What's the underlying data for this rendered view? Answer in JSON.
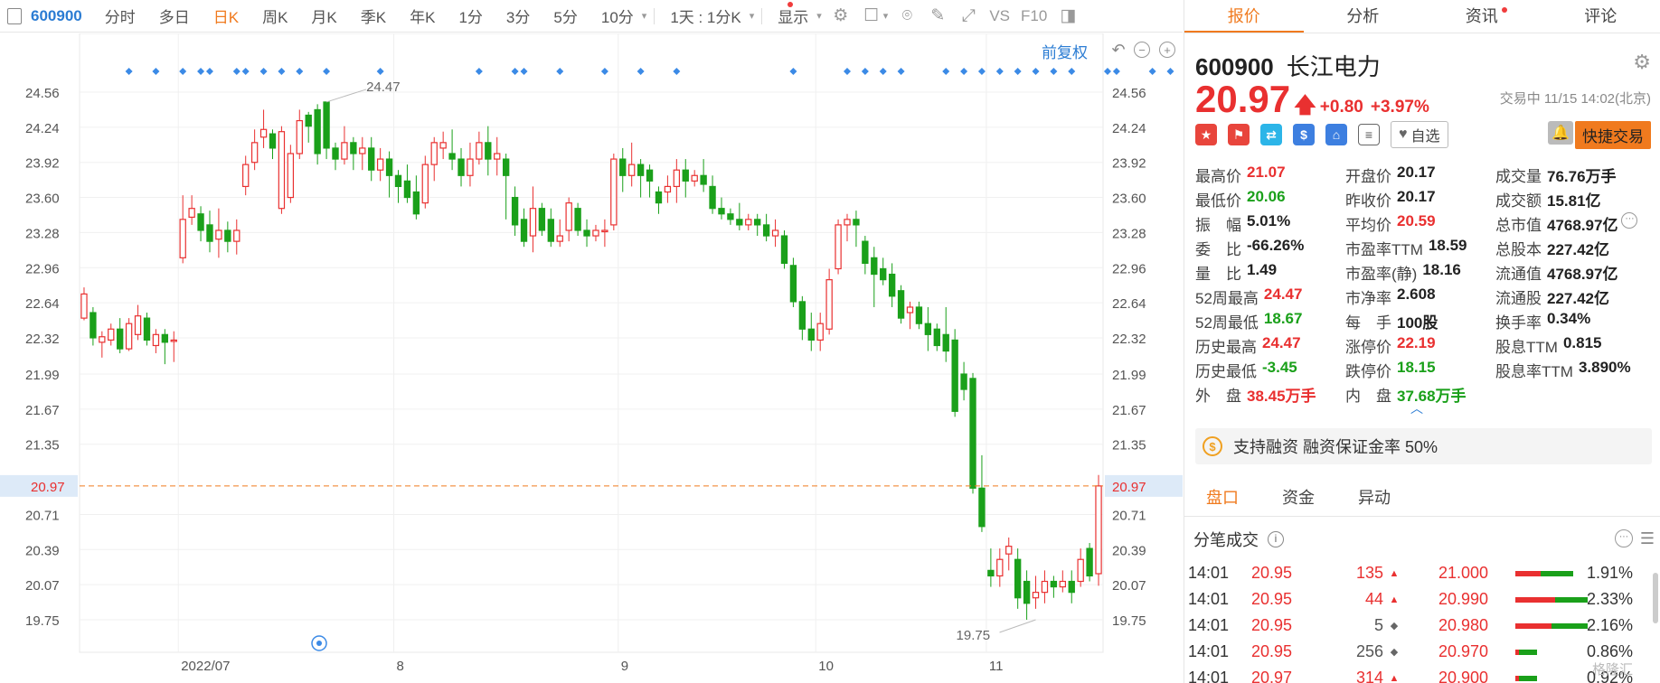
{
  "toolbar": {
    "code": "600900",
    "tabs": [
      "分时",
      "多日",
      "日K",
      "周K",
      "月K",
      "季K",
      "年K",
      "1分",
      "3分",
      "5分",
      "10分"
    ],
    "active_tab": "日K",
    "interval": "1天 : 1分K",
    "display": "显示",
    "vs": "VS",
    "f10": "F10"
  },
  "chart": {
    "restore_label": "前复权",
    "y_ticks": [
      "24.56",
      "24.24",
      "23.92",
      "23.60",
      "23.28",
      "22.96",
      "22.64",
      "22.32",
      "21.99",
      "21.67",
      "21.35",
      "20.71",
      "20.39",
      "20.07",
      "19.75"
    ],
    "x_ticks": [
      "2022/07",
      "8",
      "9",
      "10",
      "11"
    ],
    "current_price_label": "20.97",
    "high_marker": "24.47",
    "low_marker": "19.75",
    "colors": {
      "up": "#e93030",
      "down": "#1aa01a",
      "accent": "#f07a1e",
      "link": "#2b7cd3"
    }
  },
  "chart_data": {
    "type": "candlestick",
    "ylim": [
      19.5,
      24.75
    ],
    "current_price": 20.97,
    "high": 24.47,
    "low": 19.75,
    "candles": [
      [
        22.5,
        22.72,
        22.48,
        22.78
      ],
      [
        22.55,
        22.32,
        22.25,
        22.6
      ],
      [
        22.28,
        22.33,
        22.14,
        22.38
      ],
      [
        22.3,
        22.4,
        22.25,
        22.45
      ],
      [
        22.4,
        22.22,
        22.18,
        22.5
      ],
      [
        22.22,
        22.45,
        22.2,
        22.5
      ],
      [
        22.35,
        22.52,
        22.3,
        22.62
      ],
      [
        22.5,
        22.3,
        22.25,
        22.55
      ],
      [
        22.25,
        22.35,
        22.18,
        22.4
      ],
      [
        22.35,
        22.28,
        22.08,
        22.4
      ],
      [
        22.3,
        22.3,
        22.1,
        22.38
      ],
      [
        23.05,
        23.4,
        23.0,
        23.62
      ],
      [
        23.42,
        23.5,
        23.35,
        23.62
      ],
      [
        23.45,
        23.3,
        23.2,
        23.52
      ],
      [
        23.35,
        23.2,
        23.1,
        23.48
      ],
      [
        23.22,
        23.3,
        23.05,
        23.5
      ],
      [
        23.3,
        23.2,
        23.1,
        23.38
      ],
      [
        23.2,
        23.3,
        23.08,
        23.4
      ],
      [
        23.7,
        23.9,
        23.62,
        23.98
      ],
      [
        23.92,
        24.1,
        23.85,
        24.22
      ],
      [
        24.15,
        24.22,
        24.05,
        24.4
      ],
      [
        24.18,
        24.05,
        23.95,
        24.22
      ],
      [
        23.5,
        24.2,
        23.45,
        24.25
      ],
      [
        23.6,
        24.0,
        23.55,
        24.08
      ],
      [
        24.0,
        24.3,
        23.95,
        24.4
      ],
      [
        24.35,
        24.25,
        24.1,
        24.38
      ],
      [
        24.4,
        24.0,
        23.9,
        24.45
      ],
      [
        24.47,
        24.05,
        23.95,
        24.47
      ],
      [
        24.05,
        23.95,
        23.85,
        24.1
      ],
      [
        23.95,
        24.1,
        23.9,
        24.25
      ],
      [
        24.1,
        24.0,
        23.85,
        24.15
      ],
      [
        24.0,
        24.05,
        23.85,
        24.15
      ],
      [
        24.05,
        23.85,
        23.75,
        24.15
      ],
      [
        23.85,
        23.95,
        23.75,
        24.05
      ],
      [
        23.95,
        23.8,
        23.6,
        24.02
      ],
      [
        23.8,
        23.7,
        23.55,
        23.85
      ],
      [
        23.75,
        23.6,
        23.55,
        23.9
      ],
      [
        23.65,
        23.45,
        23.4,
        23.8
      ],
      [
        23.55,
        23.9,
        23.5,
        23.98
      ],
      [
        23.9,
        24.1,
        23.75,
        24.15
      ],
      [
        24.05,
        24.1,
        23.95,
        24.2
      ],
      [
        24.0,
        23.95,
        23.85,
        24.22
      ],
      [
        23.95,
        23.8,
        23.7,
        24.05
      ],
      [
        23.8,
        23.95,
        23.7,
        24.1
      ],
      [
        23.95,
        24.1,
        23.9,
        24.2
      ],
      [
        24.1,
        23.95,
        23.8,
        24.25
      ],
      [
        23.95,
        24.0,
        23.8,
        24.15
      ],
      [
        23.95,
        23.8,
        23.4,
        24.0
      ],
      [
        23.6,
        23.35,
        23.25,
        23.7
      ],
      [
        23.4,
        23.2,
        23.15,
        23.5
      ],
      [
        23.25,
        23.5,
        23.1,
        23.7
      ],
      [
        23.5,
        23.3,
        23.25,
        23.55
      ],
      [
        23.4,
        23.2,
        23.15,
        23.5
      ],
      [
        23.2,
        23.25,
        23.15,
        23.4
      ],
      [
        23.3,
        23.55,
        23.2,
        23.6
      ],
      [
        23.5,
        23.3,
        23.25,
        23.55
      ],
      [
        23.3,
        23.25,
        23.15,
        23.4
      ],
      [
        23.25,
        23.3,
        23.2,
        23.35
      ],
      [
        23.3,
        23.3,
        23.15,
        23.4
      ],
      [
        23.35,
        23.95,
        23.3,
        24.0
      ],
      [
        23.95,
        23.8,
        23.65,
        24.05
      ],
      [
        23.8,
        23.9,
        23.7,
        24.1
      ],
      [
        23.9,
        23.8,
        23.6,
        23.95
      ],
      [
        23.85,
        23.75,
        23.6,
        23.9
      ],
      [
        23.65,
        23.55,
        23.45,
        23.7
      ],
      [
        23.65,
        23.7,
        23.55,
        23.8
      ],
      [
        23.7,
        23.85,
        23.55,
        23.95
      ],
      [
        23.85,
        23.75,
        23.6,
        23.95
      ],
      [
        23.75,
        23.8,
        23.7,
        23.85
      ],
      [
        23.8,
        23.72,
        23.65,
        23.95
      ],
      [
        23.7,
        23.5,
        23.45,
        23.8
      ],
      [
        23.5,
        23.45,
        23.4,
        23.6
      ],
      [
        23.45,
        23.4,
        23.35,
        23.5
      ],
      [
        23.4,
        23.35,
        23.3,
        23.55
      ],
      [
        23.35,
        23.4,
        23.3,
        23.45
      ],
      [
        23.4,
        23.35,
        23.25,
        23.45
      ],
      [
        23.35,
        23.25,
        23.2,
        23.45
      ],
      [
        23.25,
        23.3,
        23.15,
        23.4
      ],
      [
        23.25,
        23.0,
        22.95,
        23.3
      ],
      [
        22.98,
        22.65,
        22.6,
        23.05
      ],
      [
        22.65,
        22.4,
        22.3,
        22.7
      ],
      [
        22.4,
        22.3,
        22.2,
        22.55
      ],
      [
        22.3,
        22.45,
        22.2,
        22.55
      ],
      [
        22.4,
        22.85,
        22.35,
        22.95
      ],
      [
        22.95,
        23.35,
        22.9,
        23.4
      ],
      [
        23.35,
        23.4,
        23.2,
        23.45
      ],
      [
        23.4,
        23.35,
        23.15,
        23.48
      ],
      [
        23.2,
        23.0,
        22.9,
        23.25
      ],
      [
        23.05,
        22.9,
        22.6,
        23.15
      ],
      [
        22.95,
        22.85,
        22.8,
        23.05
      ],
      [
        22.9,
        22.7,
        22.6,
        23.0
      ],
      [
        22.75,
        22.5,
        22.45,
        22.8
      ],
      [
        22.55,
        22.6,
        22.4,
        22.65
      ],
      [
        22.6,
        22.45,
        22.4,
        22.65
      ],
      [
        22.45,
        22.35,
        22.2,
        22.6
      ],
      [
        22.4,
        22.25,
        22.2,
        22.45
      ],
      [
        22.35,
        22.2,
        22.1,
        22.6
      ],
      [
        22.3,
        21.65,
        21.6,
        22.4
      ],
      [
        21.99,
        21.85,
        21.75,
        22.1
      ],
      [
        21.95,
        20.95,
        20.9,
        22.0
      ],
      [
        20.95,
        20.6,
        20.55,
        21.25
      ],
      [
        20.2,
        20.15,
        20.05,
        20.4
      ],
      [
        20.15,
        20.3,
        20.05,
        20.4
      ],
      [
        20.35,
        20.42,
        20.2,
        20.5
      ],
      [
        20.3,
        19.95,
        19.85,
        20.4
      ],
      [
        20.1,
        19.9,
        19.75,
        20.2
      ],
      [
        19.95,
        20.0,
        19.85,
        20.15
      ],
      [
        20.0,
        20.1,
        19.9,
        20.2
      ],
      [
        20.1,
        20.05,
        19.95,
        20.15
      ],
      [
        20.05,
        20.1,
        20.0,
        20.2
      ],
      [
        20.1,
        20.0,
        19.9,
        20.2
      ],
      [
        20.1,
        20.3,
        20.05,
        20.4
      ],
      [
        20.4,
        20.15,
        20.1,
        20.45
      ],
      [
        20.17,
        20.97,
        20.06,
        21.07
      ]
    ],
    "event_markers": [
      5,
      8,
      11,
      13,
      14,
      17,
      18,
      20,
      22,
      24,
      27,
      33,
      44,
      48,
      49,
      53,
      58,
      62,
      66,
      79,
      85,
      87,
      89,
      91,
      96,
      98,
      100,
      102,
      104,
      106,
      108,
      110,
      114,
      115,
      119,
      121
    ],
    "x_tick_index": [
      11,
      35,
      60,
      82,
      101
    ]
  },
  "panel": {
    "tabs": [
      "报价",
      "分析",
      "资讯",
      "评论"
    ],
    "active_tab": "报价",
    "code": "600900",
    "name": "长江电力",
    "price": "20.97",
    "change": "+0.80",
    "change_pct": "+3.97%",
    "trade_status": "交易中 11/15 14:02(北京)",
    "fav_label": "自选",
    "quick_trade_label": "快捷交易",
    "stats": [
      [
        {
          "label": "最高价",
          "value": "21.07",
          "color": "red"
        },
        {
          "label": "开盘价",
          "value": "20.17",
          "color": "normal"
        },
        {
          "label": "成交量",
          "value": "76.76万手",
          "color": "normal"
        }
      ],
      [
        {
          "label": "最低价",
          "value": "20.06",
          "color": "green"
        },
        {
          "label": "昨收价",
          "value": "20.17",
          "color": "normal"
        },
        {
          "label": "成交额",
          "value": "15.81亿",
          "color": "normal"
        }
      ],
      [
        {
          "label": "振　幅",
          "value": "5.01%",
          "color": "normal"
        },
        {
          "label": "平均价",
          "value": "20.59",
          "color": "red"
        },
        {
          "label": "总市值",
          "value": "4768.97亿",
          "color": "normal"
        }
      ],
      [
        {
          "label": "委　比",
          "value": "-66.26%",
          "color": "normal"
        },
        {
          "label": "市盈率TTM",
          "value": "18.59",
          "color": "normal"
        },
        {
          "label": "总股本",
          "value": "227.42亿",
          "color": "normal"
        }
      ],
      [
        {
          "label": "量　比",
          "value": "1.49",
          "color": "normal"
        },
        {
          "label": "市盈率(静)",
          "value": "18.16",
          "color": "normal"
        },
        {
          "label": "流通值",
          "value": "4768.97亿",
          "color": "normal"
        }
      ],
      [
        {
          "label": "52周最高",
          "value": "24.47",
          "color": "red"
        },
        {
          "label": "市净率",
          "value": "2.608",
          "color": "normal"
        },
        {
          "label": "流通股",
          "value": "227.42亿",
          "color": "normal"
        }
      ],
      [
        {
          "label": "52周最低",
          "value": "18.67",
          "color": "green"
        },
        {
          "label": "每　手",
          "value": "100股",
          "color": "normal"
        },
        {
          "label": "换手率",
          "value": "0.34%",
          "color": "normal"
        }
      ],
      [
        {
          "label": "历史最高",
          "value": "24.47",
          "color": "red"
        },
        {
          "label": "涨停价",
          "value": "22.19",
          "color": "red"
        },
        {
          "label": "股息TTM",
          "value": "0.815",
          "color": "normal"
        }
      ],
      [
        {
          "label": "历史最低",
          "value": "-3.45",
          "color": "green"
        },
        {
          "label": "跌停价",
          "value": "18.15",
          "color": "green"
        },
        {
          "label": "股息率TTM",
          "value": "3.890%",
          "color": "normal"
        }
      ],
      [
        {
          "label": "外　盘",
          "value": "38.45万手",
          "color": "red"
        },
        {
          "label": "内　盘",
          "value": "37.68万手",
          "color": "green"
        },
        {
          "label": "",
          "value": "",
          "color": "normal"
        }
      ]
    ],
    "margin_text": "支持融资 融资保证金率 50%",
    "sub_tabs": [
      "盘口",
      "资金",
      "异动"
    ],
    "sub_active": "盘口",
    "ticks_title": "分笔成交",
    "ticks": [
      {
        "time": "14:01",
        "price": "20.95",
        "vol": "135",
        "dir": "up",
        "bid": "21.000",
        "pct": "1.91%",
        "ratio": [
          0.35,
          0.45
        ]
      },
      {
        "time": "14:01",
        "price": "20.95",
        "vol": "44",
        "dir": "up",
        "bid": "20.990",
        "pct": "2.33%",
        "ratio": [
          0.55,
          0.45
        ]
      },
      {
        "time": "14:01",
        "price": "20.95",
        "vol": "5",
        "dir": "flat",
        "bid": "20.980",
        "pct": "2.16%",
        "ratio": [
          0.5,
          0.5
        ]
      },
      {
        "time": "14:01",
        "price": "20.95",
        "vol": "256",
        "dir": "flat",
        "bid": "20.970",
        "pct": "0.86%",
        "ratio": [
          0.05,
          0.25
        ]
      },
      {
        "time": "14:01",
        "price": "20.97",
        "vol": "314",
        "dir": "up",
        "bid": "20.900",
        "pct": "0.92%",
        "ratio": [
          0.05,
          0.25
        ]
      }
    ],
    "watermark": "格隆汇"
  }
}
